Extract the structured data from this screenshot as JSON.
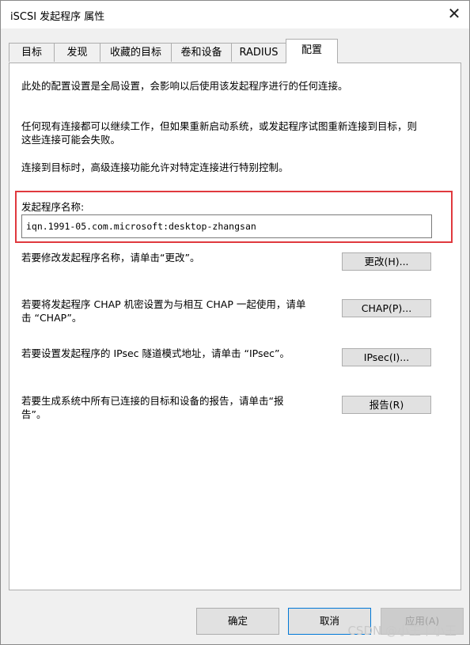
{
  "window": {
    "title": "iSCSI 发起程序 属性",
    "close_icon": "close-icon"
  },
  "tabs": [
    {
      "label": "目标"
    },
    {
      "label": "发现"
    },
    {
      "label": "收藏的目标"
    },
    {
      "label": "卷和设备"
    },
    {
      "label": "RADIUS"
    },
    {
      "label": "配置",
      "active": true
    }
  ],
  "panel": {
    "intro_1": "此处的配置设置是全局设置，会影响以后使用该发起程序进行的任何连接。",
    "intro_2": "任何现有连接都可以继续工作，但如果重新启动系统，或发起程序试图重新连接到目标，则这些连接可能会失败。",
    "intro_3": "连接到目标时，高级连接功能允许对特定连接进行特别控制。",
    "initiator_name_label": "发起程序名称:",
    "initiator_name_value": "iqn.1991-05.com.microsoft:desktop-zhangsan",
    "change_text": "若要修改发起程序名称，请单击“更改”。",
    "change_button": "更改(H)...",
    "chap_text": "若要将发起程序 CHAP 机密设置为与相互 CHAP 一起使用，请单击 “CHAP”。",
    "chap_button": "CHAP(P)...",
    "ipsec_text": "若要设置发起程序的 IPsec 隧道模式地址，请单击 “IPsec”。",
    "ipsec_button": "IPsec(I)...",
    "report_text": "若要生成系统中所有已连接的目标和设备的报告，请单击“报告”。",
    "report_button": "报告(R)"
  },
  "footer": {
    "ok_button": "确定",
    "cancel_button": "取消",
    "apply_button": "应用(A)"
  },
  "watermark": "CSDN @小王丨小王",
  "colors": {
    "highlight_border": "#e0393e",
    "default_button_border": "#0078d7"
  }
}
